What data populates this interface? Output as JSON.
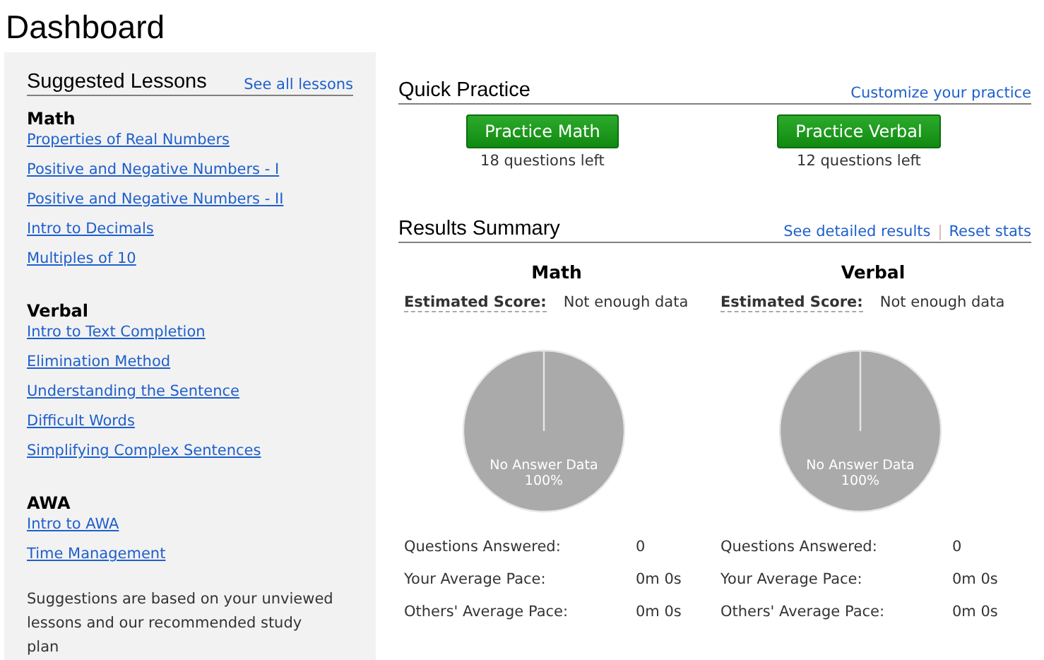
{
  "title": "Dashboard",
  "suggested": {
    "heading": "Suggested Lessons",
    "link": "See all lessons",
    "groups": [
      {
        "name": "Math",
        "lessons": [
          "Properties of Real Numbers",
          "Positive and Negative Numbers - I",
          "Positive and Negative Numbers - II",
          "Intro to Decimals",
          "Multiples of 10"
        ]
      },
      {
        "name": "Verbal",
        "lessons": [
          "Intro to Text Completion",
          "Elimination Method",
          "Understanding the Sentence",
          "Difficult Words",
          "Simplifying Complex Sentences"
        ]
      },
      {
        "name": "AWA",
        "lessons": [
          "Intro to AWA",
          "Time Management"
        ]
      }
    ],
    "note": "Suggestions are based on your unviewed lessons and our recommended study plan"
  },
  "quick_practice": {
    "heading": "Quick Practice",
    "link": "Customize your practice",
    "items": [
      {
        "button": "Practice Math",
        "left": "18 questions left"
      },
      {
        "button": "Practice Verbal",
        "left": "12 questions left"
      }
    ]
  },
  "results": {
    "heading": "Results Summary",
    "links": [
      "See detailed results",
      "Reset stats"
    ],
    "subjects": [
      {
        "name": "Math",
        "score_label": "Estimated Score:",
        "score": "Not enough data",
        "chart_data": {
          "type": "pie",
          "categories": [
            "No Answer Data"
          ],
          "values": [
            100
          ],
          "value_labels": [
            "100%"
          ]
        },
        "stats": [
          {
            "label": "Questions Answered:",
            "value": "0"
          },
          {
            "label": "Your Average Pace:",
            "value": "0m 0s"
          },
          {
            "label": "Others' Average Pace:",
            "value": "0m 0s"
          }
        ]
      },
      {
        "name": "Verbal",
        "score_label": "Estimated Score:",
        "score": "Not enough data",
        "chart_data": {
          "type": "pie",
          "categories": [
            "No Answer Data"
          ],
          "values": [
            100
          ],
          "value_labels": [
            "100%"
          ]
        },
        "stats": [
          {
            "label": "Questions Answered:",
            "value": "0"
          },
          {
            "label": "Your Average Pace:",
            "value": "0m 0s"
          },
          {
            "label": "Others' Average Pace:",
            "value": "0m 0s"
          }
        ]
      }
    ]
  }
}
